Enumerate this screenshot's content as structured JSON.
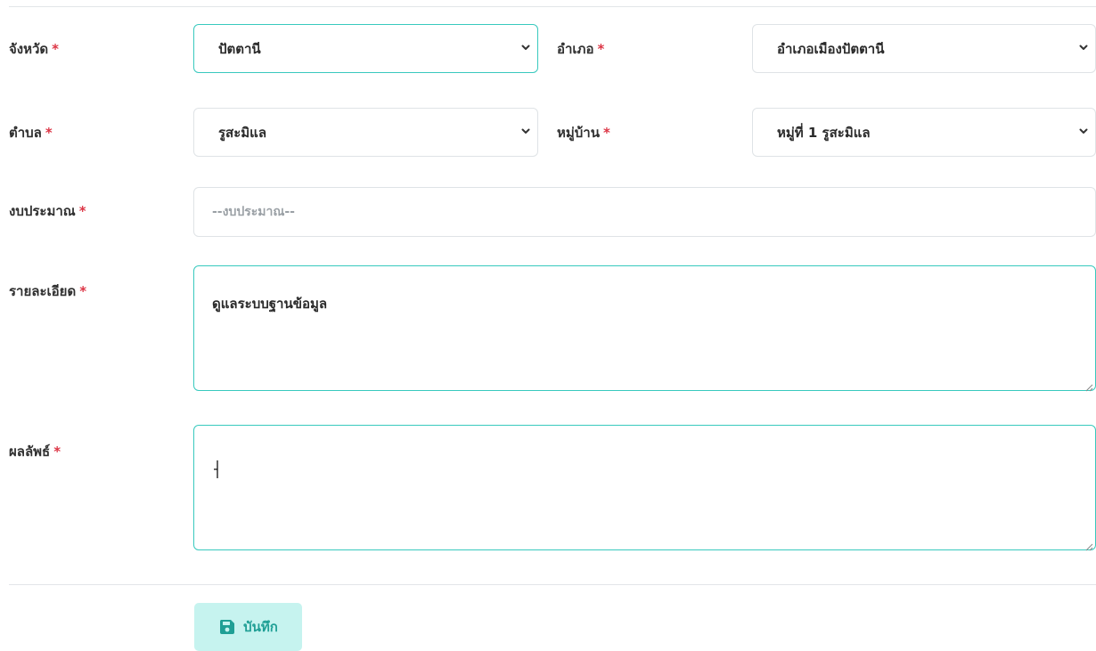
{
  "required_mark": "*",
  "form": {
    "province": {
      "label": "จังหวัด",
      "value": "ปัตตานี"
    },
    "district": {
      "label": "อำเภอ",
      "value": "อำเภอเมืองปัตตานี"
    },
    "subdistrict": {
      "label": "ตำบล",
      "value": "รูสะมิแล"
    },
    "village": {
      "label": "หมู่บ้าน",
      "value": "หมู่ที่ 1 รูสะมิแล"
    },
    "budget": {
      "label": "งบประมาณ",
      "value": "",
      "placeholder": "--งบประมาณ--"
    },
    "details": {
      "label": "รายละเอียด",
      "value": "ดูแลระบบฐานข้อมูล"
    },
    "result": {
      "label": "ผลลัพธ์",
      "value": ""
    }
  },
  "actions": {
    "save_label": "บันทึก"
  },
  "colors": {
    "accent": "#38c9be",
    "required": "#dc3545",
    "button_bg": "#c6f3ef",
    "button_text": "#1f9f95"
  },
  "icons": {
    "select": "chevron-down-icon",
    "save": "floppy-disk-icon",
    "resize": "resize-handle-icon"
  }
}
